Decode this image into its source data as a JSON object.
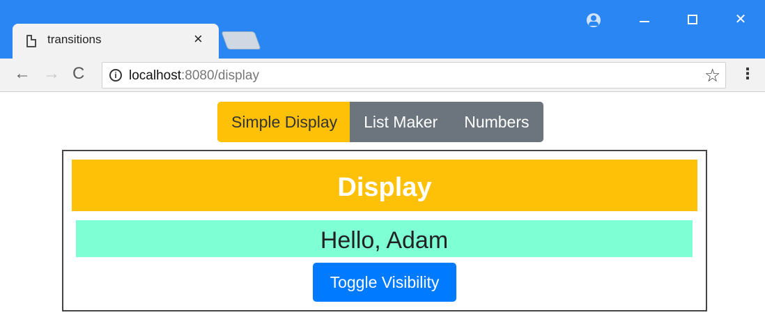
{
  "browser": {
    "tab": {
      "title": "transitions",
      "close_glyph": "×"
    },
    "window_controls": {
      "minimize": "–",
      "maximize": "☐",
      "close": "✕"
    },
    "nav": {
      "back": "←",
      "forward": "→",
      "reload": "C"
    },
    "address_bar": {
      "host": "localhost",
      "rest": ":8080/display"
    },
    "bookmark_glyph": "☆",
    "menu_glyph": "⋮",
    "info_glyph": "i"
  },
  "app": {
    "nav_buttons": [
      {
        "label": "Simple Display",
        "active": true
      },
      {
        "label": "List Maker",
        "active": false
      },
      {
        "label": "Numbers",
        "active": false
      }
    ],
    "banner": "Display",
    "message": "Hello, Adam",
    "toggle_button": "Toggle Visibility"
  },
  "colors": {
    "title_bar": "#2a86f2",
    "active_nav": "#ffc107",
    "inactive_nav": "#6c757d",
    "banner": "#ffc107",
    "message_box": "#7fffd4",
    "toggle_button": "#007bff"
  }
}
